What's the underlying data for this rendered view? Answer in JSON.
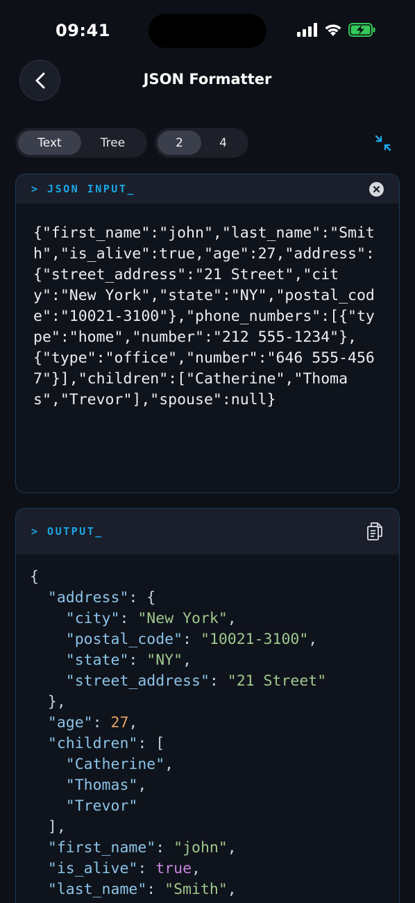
{
  "status": {
    "time": "09:41"
  },
  "header": {
    "title": "JSON Formatter"
  },
  "view_mode": {
    "options": [
      "Text",
      "Tree"
    ],
    "selected": "Text"
  },
  "indent": {
    "options": [
      "2",
      "4"
    ],
    "selected": "2"
  },
  "input_panel": {
    "label": "> JSON INPUT_",
    "value": "{\"first_name\":\"john\",\"last_name\":\"Smith\",\"is_alive\":true,\"age\":27,\"address\":{\"street_address\":\"21 Street\",\"city\":\"New York\",\"state\":\"NY\",\"postal_code\":\"10021-3100\"},\"phone_numbers\":[{\"type\":\"home\",\"number\":\"212 555-1234\"},{\"type\":\"office\",\"number\":\"646 555-4567\"}],\"children\":[\"Catherine\",\"Thomas\",\"Trevor\"],\"spouse\":null}"
  },
  "output_panel": {
    "label": "> OUTPUT_",
    "lines": [
      [
        {
          "t": "p",
          "v": "{"
        }
      ],
      [
        {
          "t": "p",
          "v": "  "
        },
        {
          "t": "k",
          "v": "\"address\""
        },
        {
          "t": "p",
          "v": ": {"
        }
      ],
      [
        {
          "t": "p",
          "v": "    "
        },
        {
          "t": "k",
          "v": "\"city\""
        },
        {
          "t": "p",
          "v": ": "
        },
        {
          "t": "s",
          "v": "\"New York\""
        },
        {
          "t": "p",
          "v": ","
        }
      ],
      [
        {
          "t": "p",
          "v": "    "
        },
        {
          "t": "k",
          "v": "\"postal_code\""
        },
        {
          "t": "p",
          "v": ": "
        },
        {
          "t": "s",
          "v": "\"10021-3100\""
        },
        {
          "t": "p",
          "v": ","
        }
      ],
      [
        {
          "t": "p",
          "v": "    "
        },
        {
          "t": "k",
          "v": "\"state\""
        },
        {
          "t": "p",
          "v": ": "
        },
        {
          "t": "s",
          "v": "\"NY\""
        },
        {
          "t": "p",
          "v": ","
        }
      ],
      [
        {
          "t": "p",
          "v": "    "
        },
        {
          "t": "k",
          "v": "\"street_address\""
        },
        {
          "t": "p",
          "v": ": "
        },
        {
          "t": "s",
          "v": "\"21 Street\""
        }
      ],
      [
        {
          "t": "p",
          "v": "  },"
        }
      ],
      [
        {
          "t": "p",
          "v": "  "
        },
        {
          "t": "k",
          "v": "\"age\""
        },
        {
          "t": "p",
          "v": ": "
        },
        {
          "t": "n",
          "v": "27"
        },
        {
          "t": "p",
          "v": ","
        }
      ],
      [
        {
          "t": "p",
          "v": "  "
        },
        {
          "t": "k",
          "v": "\"children\""
        },
        {
          "t": "p",
          "v": ": ["
        }
      ],
      [
        {
          "t": "p",
          "v": "    "
        },
        {
          "t": "k",
          "v": "\"Catherine\""
        },
        {
          "t": "p",
          "v": ","
        }
      ],
      [
        {
          "t": "p",
          "v": "    "
        },
        {
          "t": "k",
          "v": "\"Thomas\""
        },
        {
          "t": "p",
          "v": ","
        }
      ],
      [
        {
          "t": "p",
          "v": "    "
        },
        {
          "t": "k",
          "v": "\"Trevor\""
        }
      ],
      [
        {
          "t": "p",
          "v": "  ],"
        }
      ],
      [
        {
          "t": "p",
          "v": "  "
        },
        {
          "t": "k",
          "v": "\"first_name\""
        },
        {
          "t": "p",
          "v": ": "
        },
        {
          "t": "s",
          "v": "\"john\""
        },
        {
          "t": "p",
          "v": ","
        }
      ],
      [
        {
          "t": "p",
          "v": "  "
        },
        {
          "t": "k",
          "v": "\"is_alive\""
        },
        {
          "t": "p",
          "v": ": "
        },
        {
          "t": "b",
          "v": "true"
        },
        {
          "t": "p",
          "v": ","
        }
      ],
      [
        {
          "t": "p",
          "v": "  "
        },
        {
          "t": "k",
          "v": "\"last_name\""
        },
        {
          "t": "p",
          "v": ": "
        },
        {
          "t": "s",
          "v": "\"Smith\""
        },
        {
          "t": "p",
          "v": ","
        }
      ]
    ]
  },
  "colors": {
    "accent": "#1aa7e6",
    "key": "#8cc4e8",
    "string": "#9fc88e",
    "number": "#e8a365",
    "boolean": "#c985e0",
    "battery": "#35c759"
  },
  "icons": [
    "chevron-left-icon",
    "collapse-icon",
    "clear-icon",
    "copy-icon",
    "signal-icon",
    "wifi-icon",
    "battery-charging-icon"
  ]
}
